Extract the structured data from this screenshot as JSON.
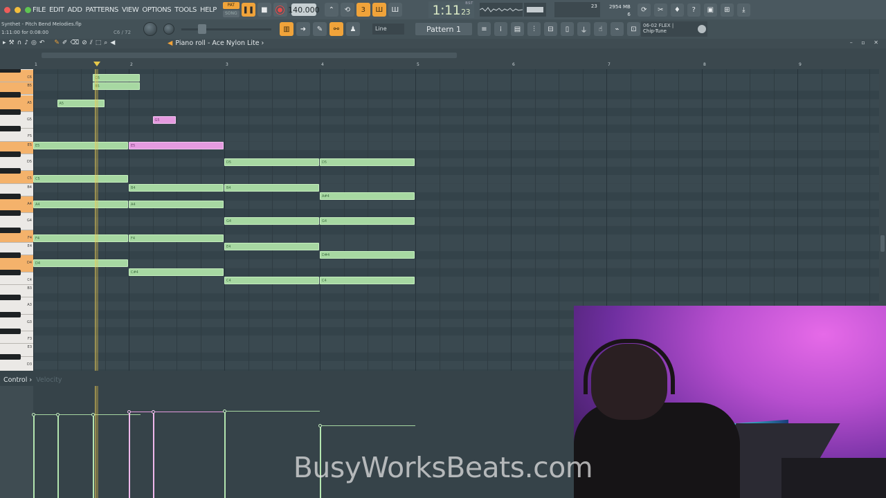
{
  "menu": [
    "FILE",
    "EDIT",
    "ADD",
    "PATTERNS",
    "VIEW",
    "OPTIONS",
    "TOOLS",
    "HELP"
  ],
  "transport": {
    "pat": "PAT",
    "song": "SONG",
    "tempo": "140.000",
    "time_main": "1:11",
    "time_sub": "23",
    "time_unit": "B:S:T",
    "cpu_value": "23",
    "mem_value": "2954 MB",
    "poly_value": "6"
  },
  "project": {
    "file": "Synthet - Pitch Bend Melodies.flp",
    "time": "1:11:00 for 0:08:00",
    "note_info": "C6 / 72"
  },
  "toolbar2": {
    "snap": "Line",
    "pattern": "Pattern 1",
    "hint_top": "06-02  FLEX |",
    "hint_bottom": "Chip-Tune"
  },
  "pianoroll": {
    "title": "Piano roll - Ace Nylon Lite",
    "bar_numbers": [
      "1",
      "2",
      "3",
      "4",
      "5",
      "6",
      "7",
      "8",
      "9"
    ],
    "control_label": "Control",
    "control_sub": "Velocity"
  },
  "keys": [
    {
      "name": "C6",
      "hl": true
    },
    {
      "name": "B5",
      "hl": true
    },
    {
      "name": "A5",
      "hl": true
    },
    {
      "name": "G5",
      "hl": false
    },
    {
      "name": "F5",
      "hl": false
    },
    {
      "name": "E5",
      "hl": true
    },
    {
      "name": "D5",
      "hl": false
    },
    {
      "name": "C5",
      "hl": true
    },
    {
      "name": "B4",
      "hl": false
    },
    {
      "name": "A4",
      "hl": true
    },
    {
      "name": "G4",
      "hl": false
    },
    {
      "name": "F4",
      "hl": true
    },
    {
      "name": "E4",
      "hl": false
    },
    {
      "name": "D4",
      "hl": true
    },
    {
      "name": "C4",
      "hl": false
    },
    {
      "name": "B3",
      "hl": false
    },
    {
      "name": "A3",
      "hl": false
    },
    {
      "name": "G3",
      "hl": false
    },
    {
      "name": "F3",
      "hl": false
    },
    {
      "name": "E3",
      "hl": false
    },
    {
      "name": "D3",
      "hl": false
    }
  ],
  "notes": [
    {
      "pitch": "C6",
      "start": 1.625,
      "len": 0.5,
      "color": "green"
    },
    {
      "pitch": "B5",
      "start": 1.625,
      "len": 0.5,
      "color": "green"
    },
    {
      "pitch": "A5",
      "start": 1.25,
      "len": 0.5,
      "color": "green"
    },
    {
      "pitch": "G5",
      "start": 2.25,
      "len": 0.25,
      "color": "pink"
    },
    {
      "pitch": "E5",
      "start": 1,
      "len": 1,
      "color": "green"
    },
    {
      "pitch": "E5",
      "start": 2,
      "len": 1,
      "color": "pink"
    },
    {
      "pitch": "D5",
      "start": 3,
      "len": 1,
      "color": "green"
    },
    {
      "pitch": "D5",
      "start": 4,
      "len": 1,
      "color": "green"
    },
    {
      "pitch": "C5",
      "start": 1,
      "len": 1,
      "color": "green"
    },
    {
      "pitch": "B4",
      "start": 2,
      "len": 1,
      "color": "green"
    },
    {
      "pitch": "B4",
      "start": 3,
      "len": 1,
      "color": "green"
    },
    {
      "pitch": "A#4",
      "start": 4,
      "len": 1,
      "color": "green"
    },
    {
      "pitch": "A4",
      "start": 1,
      "len": 1,
      "color": "green"
    },
    {
      "pitch": "A4",
      "start": 2,
      "len": 1,
      "color": "green"
    },
    {
      "pitch": "G4",
      "start": 3,
      "len": 1,
      "color": "green"
    },
    {
      "pitch": "G4",
      "start": 4,
      "len": 1,
      "color": "green"
    },
    {
      "pitch": "F4",
      "start": 1,
      "len": 1,
      "color": "green"
    },
    {
      "pitch": "F4",
      "start": 2,
      "len": 1,
      "color": "green"
    },
    {
      "pitch": "E4",
      "start": 3,
      "len": 1,
      "color": "green"
    },
    {
      "pitch": "D#4",
      "start": 4,
      "len": 1,
      "color": "green"
    },
    {
      "pitch": "D4",
      "start": 1,
      "len": 1,
      "color": "green"
    },
    {
      "pitch": "C#4",
      "start": 2,
      "len": 1,
      "color": "green"
    },
    {
      "pitch": "C4",
      "start": 3,
      "len": 1,
      "color": "green"
    },
    {
      "pitch": "C4",
      "start": 4,
      "len": 1,
      "color": "green"
    }
  ],
  "playhead_bar": 1.67,
  "velocities": [
    {
      "start": 1,
      "len": 1,
      "level": 0.75,
      "color": "green"
    },
    {
      "start": 1.25,
      "len": 0.5,
      "level": 0.75,
      "color": "green"
    },
    {
      "start": 1.625,
      "len": 0.5,
      "level": 0.75,
      "color": "green"
    },
    {
      "start": 2,
      "len": 1,
      "level": 0.77,
      "color": "pink"
    },
    {
      "start": 2.25,
      "len": 0.25,
      "level": 0.77,
      "color": "pink"
    },
    {
      "start": 3,
      "len": 1,
      "level": 0.78,
      "color": "green"
    },
    {
      "start": 4,
      "len": 1,
      "level": 0.65,
      "color": "green"
    }
  ],
  "watermark": "BusyWorksBeats.com",
  "colors": {
    "accent": "#f0a33a",
    "note_green": "#a7d8a2",
    "note_pink": "#e59be0",
    "playhead": "#e6c84a"
  }
}
